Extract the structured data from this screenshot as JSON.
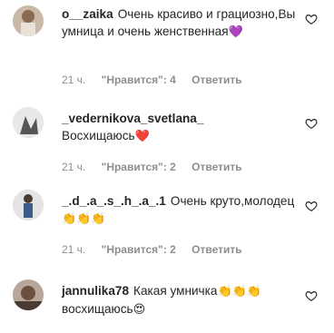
{
  "comments": [
    {
      "username": "o__zaika",
      "text": "Очень красиво и грациозно,Вы умница и очень женственная",
      "emoji": "💜",
      "time": "21 ч.",
      "likes": "\"Нравится\": 4",
      "reply": "Ответить"
    },
    {
      "username": "_vedernikova_svetlana_",
      "text": "Восхищаюсь",
      "emoji": "❤️",
      "time": "21 ч.",
      "likes": "\"Нравится\": 2",
      "reply": "Ответить"
    },
    {
      "username": "_.d_.a_.s_.h_.a_.1",
      "text": "Очень круто,молодец",
      "emoji": "👏👏👏",
      "time": "21 ч.",
      "likes": "\"Нравится\": 2",
      "reply": "Ответить"
    },
    {
      "username": "jannulika78",
      "text": "Какая умничка",
      "emoji": "👏👏👏",
      "text2": "восхищаюсь",
      "emoji2": "😍",
      "time": "",
      "likes": "",
      "reply": ""
    }
  ],
  "icons": {
    "like": "heart-outline-icon"
  },
  "colors": {
    "text": "#262626",
    "meta": "#8e8e8e",
    "purple_heart": "#8e5bd8",
    "red_heart": "#e0245e",
    "clap": "#f2b822"
  }
}
